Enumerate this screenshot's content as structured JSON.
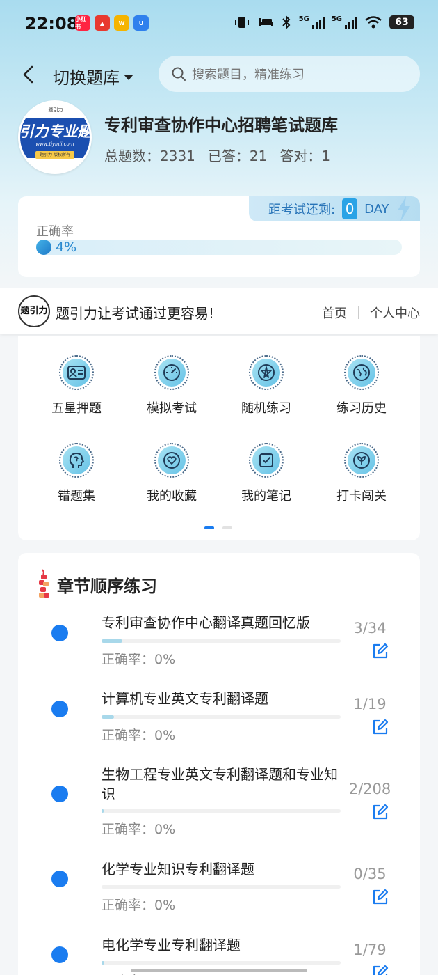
{
  "status_bar": {
    "time": "22:08",
    "app_badges": [
      {
        "label": "小红书",
        "color": "#ff2442"
      },
      {
        "label": "▲",
        "color": "#e8392f"
      },
      {
        "label": "W",
        "color": "#f5b400"
      },
      {
        "label": "U",
        "color": "#2f80ed"
      }
    ],
    "network_1": "5G",
    "network_2": "5G",
    "battery": "63"
  },
  "header": {
    "switch_label": "切换题库",
    "search_placeholder": "搜索题目，精准练习"
  },
  "bank": {
    "logo_text": "引力专业题",
    "logo_url": "www.tiyinli.com",
    "logo_foot": "题引力 版权所有",
    "logo_top": "题引力",
    "title": "专利审查协作中心招聘笔试题库",
    "total_label": "总题数：2331",
    "answered_label": "已答：21",
    "correct_label": "答对：1"
  },
  "accuracy": {
    "countdown_label": "距考试还剩:",
    "countdown_days": "0",
    "countdown_unit": "DAY",
    "label": "正确率",
    "value_text": "4%",
    "value": 4
  },
  "promo": {
    "logo": "题引力",
    "text": "题引力让考试通过更容易!",
    "link_home": "首页",
    "link_profile": "个人中心"
  },
  "menu": [
    {
      "label": "五星押题",
      "icon": "id-card-icon"
    },
    {
      "label": "模拟考试",
      "icon": "gauge-icon"
    },
    {
      "label": "随机练习",
      "icon": "shuffle-icon"
    },
    {
      "label": "练习历史",
      "icon": "globe-icon"
    },
    {
      "label": "错题集",
      "icon": "brain-icon"
    },
    {
      "label": "我的收藏",
      "icon": "heart-icon"
    },
    {
      "label": "我的笔记",
      "icon": "note-icon"
    },
    {
      "label": "打卡闯关",
      "icon": "leaf-icon"
    }
  ],
  "chapters": {
    "title": "章节顺序练习",
    "items": [
      {
        "name": "专利审查协作中心翻译真题回忆版",
        "count": "3/34",
        "progress": 0.088,
        "accuracy": "正确率：0%"
      },
      {
        "name": "计算机专业英文专利翻译题",
        "count": "1/19",
        "progress": 0.053,
        "accuracy": "正确率：0%"
      },
      {
        "name": "生物工程专业英文专利翻译题和专业知识",
        "count": "2/208",
        "progress": 0.0096,
        "accuracy": "正确率：0%"
      },
      {
        "name": "化学专业知识专利翻译题",
        "count": "0/35",
        "progress": 0,
        "accuracy": "正确率：0%"
      },
      {
        "name": "电化学专业专利翻译题",
        "count": "1/79",
        "progress": 0.0127,
        "accuracy": "正确率：0%"
      }
    ]
  },
  "colors": {
    "accent": "#1a7cf0",
    "countdown": "#2aa3e6",
    "progress": "#a8d8ea"
  }
}
